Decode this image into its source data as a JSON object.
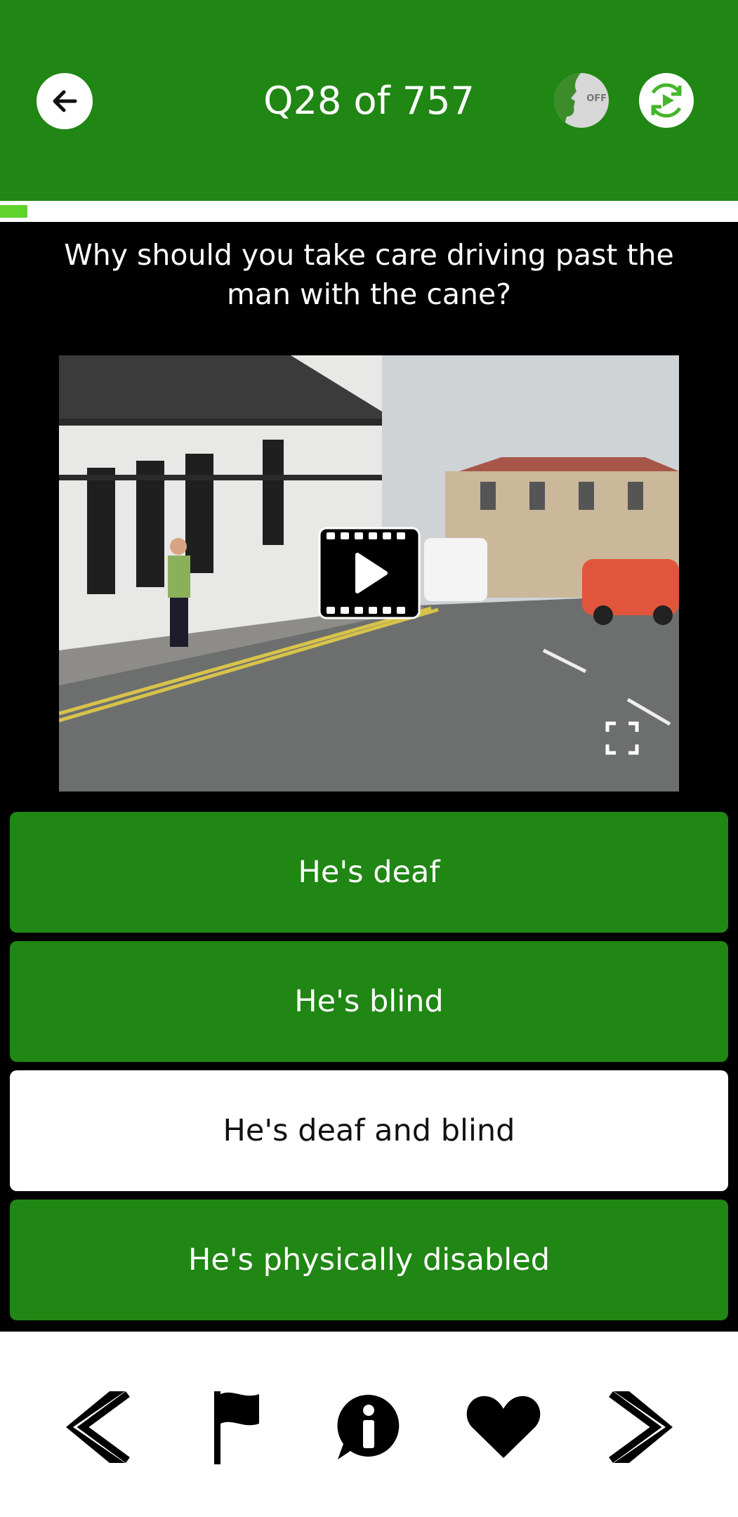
{
  "header": {
    "title": "Q28 of 757",
    "voice_off_label": "OFF"
  },
  "progress": {
    "current": 28,
    "total": 757,
    "fraction": 0.037
  },
  "question": {
    "line1": "Why should you take care driving past the",
    "line2": "man with the cane?"
  },
  "answers": [
    {
      "label": "He's deaf",
      "state": "default"
    },
    {
      "label": "He's blind",
      "state": "default"
    },
    {
      "label": "He's deaf and blind",
      "state": "selected"
    },
    {
      "label": "He's physically disabled",
      "state": "default"
    }
  ],
  "colors": {
    "brand_green": "#208614",
    "progress_green": "#5fd32c",
    "selected_bg": "#ffffff"
  },
  "bottom_nav": [
    "previous-icon",
    "flag-icon",
    "info-icon",
    "heart-icon",
    "next-icon"
  ]
}
